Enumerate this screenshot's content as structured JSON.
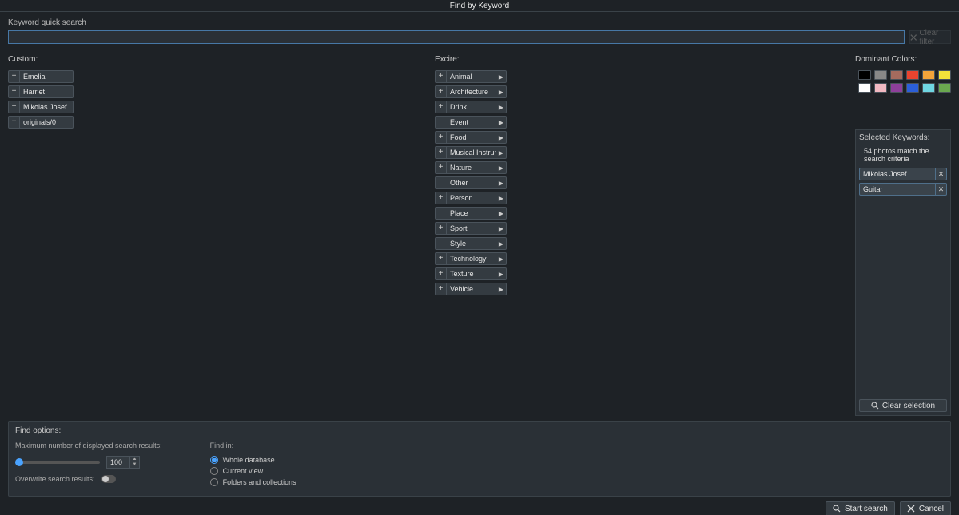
{
  "window": {
    "title": "Find by Keyword"
  },
  "search": {
    "label": "Keyword quick search",
    "placeholder": "",
    "clear_filter_label": "Clear filter"
  },
  "columns": {
    "custom_label": "Custom:",
    "excire_label": "Excire:",
    "dominant_label": "Dominant Colors:"
  },
  "custom_keywords": [
    {
      "label": "Emelia"
    },
    {
      "label": "Harriet"
    },
    {
      "label": "Mikolas Josef"
    },
    {
      "label": "originals/0"
    }
  ],
  "excire_keywords": [
    {
      "label": "Animal",
      "plus": true,
      "arrow": true
    },
    {
      "label": "Architecture",
      "plus": true,
      "arrow": true
    },
    {
      "label": "Drink",
      "plus": true,
      "arrow": true
    },
    {
      "label": "Event",
      "plus": false,
      "arrow": true
    },
    {
      "label": "Food",
      "plus": true,
      "arrow": true
    },
    {
      "label": "Musical Instrument",
      "plus": true,
      "arrow": true
    },
    {
      "label": "Nature",
      "plus": true,
      "arrow": true
    },
    {
      "label": "Other",
      "plus": false,
      "arrow": true
    },
    {
      "label": "Person",
      "plus": true,
      "arrow": true
    },
    {
      "label": "Place",
      "plus": false,
      "arrow": true
    },
    {
      "label": "Sport",
      "plus": true,
      "arrow": true
    },
    {
      "label": "Style",
      "plus": false,
      "arrow": true
    },
    {
      "label": "Technology",
      "plus": true,
      "arrow": true
    },
    {
      "label": "Texture",
      "plus": true,
      "arrow": true
    },
    {
      "label": "Vehicle",
      "plus": true,
      "arrow": true
    }
  ],
  "colors": [
    "#000000",
    "#888888",
    "#a46b5e",
    "#e8442f",
    "#f3a43a",
    "#f4e23a",
    "#ffffff",
    "#f2b9c2",
    "#8e3f9a",
    "#2b5fd9",
    "#6fd6e2",
    "#6aa84f"
  ],
  "selected_panel": {
    "heading": "Selected Keywords:",
    "count_text": "54 photos match the search criteria",
    "chips": [
      {
        "label": "Mikolas Josef"
      },
      {
        "label": "Guitar"
      }
    ],
    "clear_label": "Clear selection"
  },
  "footer": {
    "heading": "Find options:",
    "max_results_label": "Maximum number of displayed search results:",
    "max_results_value": "100",
    "overwrite_label": "Overwrite search results:",
    "findin_label": "Find in:",
    "findin_options": [
      {
        "label": "Whole database",
        "checked": true
      },
      {
        "label": "Current view",
        "checked": false
      },
      {
        "label": "Folders and collections",
        "checked": false
      }
    ]
  },
  "buttons": {
    "start": "Start search",
    "cancel": "Cancel"
  }
}
